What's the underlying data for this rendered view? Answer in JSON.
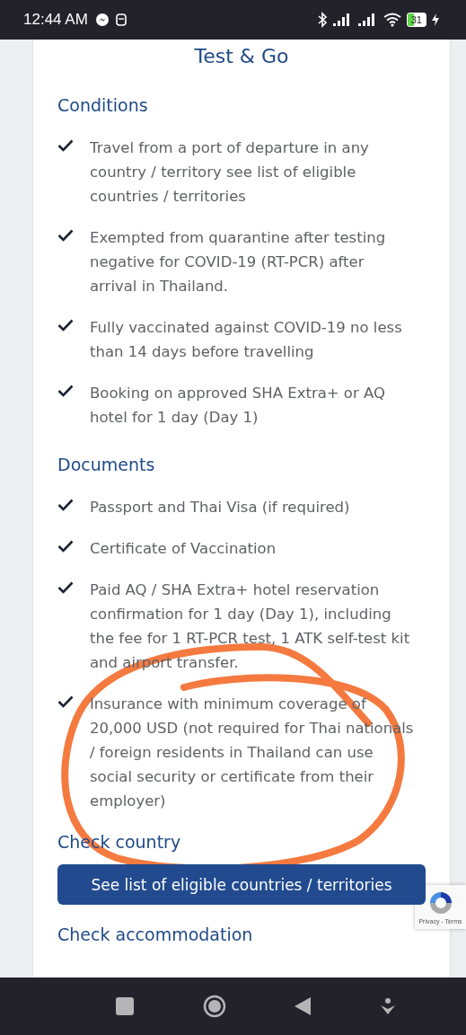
{
  "status_bar": {
    "time": "12:44 AM",
    "battery": "31"
  },
  "page": {
    "title": "Test & Go",
    "sections": [
      {
        "heading": "Conditions",
        "items": [
          "Travel from a port of departure in any country / territory see list of eligible countries / territories",
          "Exempted from quarantine after testing negative for COVID-19 (RT-PCR) after arrival in Thailand.",
          "Fully vaccinated against COVID-19 no less than 14 days before travelling",
          "Booking on approved SHA Extra+ or AQ hotel for 1 day (Day 1)"
        ]
      },
      {
        "heading": "Documents",
        "items": [
          "Passport and Thai Visa (if required)",
          "Certificate of Vaccination",
          "Paid AQ / SHA Extra+ hotel reservation confirmation for 1 day (Day 1), including the fee for 1 RT-PCR test, 1 ATK self-test kit and airport transfer.",
          "Insurance with minimum coverage of 20,000 USD (not required for Thai nationals / foreign residents in Thailand can use social security or certificate from their employer)"
        ]
      }
    ],
    "check_country": {
      "heading": "Check country",
      "button": "See list of eligible countries / territories"
    },
    "check_accommodation": {
      "heading": "Check accommodation"
    }
  },
  "recaptcha": {
    "links": "Privacy - Terms"
  }
}
